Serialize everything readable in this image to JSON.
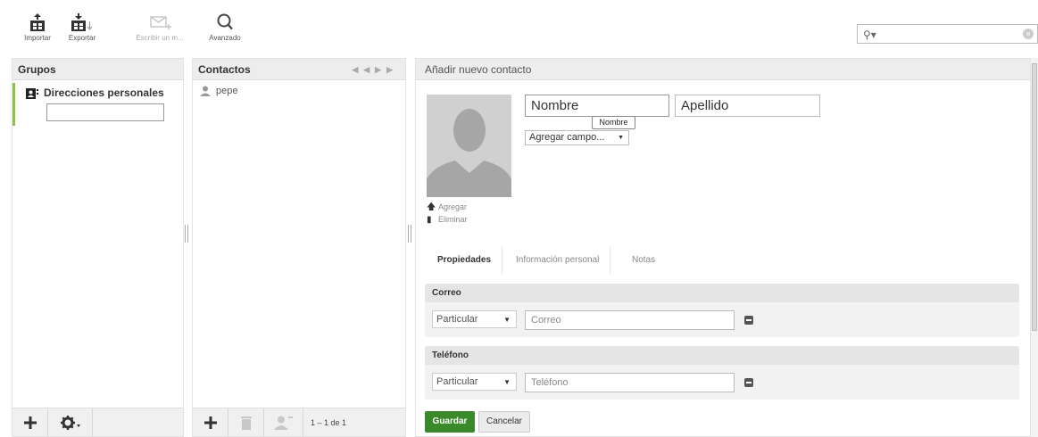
{
  "toolbar": {
    "importar": "Importar",
    "exportar": "Exportar",
    "escribir": "Escribir un m...",
    "avanzado": "Avanzado"
  },
  "search": {
    "value": ""
  },
  "groups": {
    "title": "Grupos",
    "items": [
      {
        "label": "Direcciones personales"
      }
    ],
    "new_group_value": ""
  },
  "contacts": {
    "title": "Contactos",
    "items": [
      {
        "name": "pepe"
      }
    ],
    "page_count": "1 – 1 de 1"
  },
  "editor": {
    "title": "Añadir nuevo contacto",
    "first_name_placeholder": "Nombre",
    "last_name_placeholder": "Apellido",
    "tooltip": "Nombre",
    "add_field": "Agregar campo...",
    "photo_add": "Agregar",
    "photo_delete": "Eliminar",
    "tabs": [
      {
        "label": "Propiedades"
      },
      {
        "label": "Información personal"
      },
      {
        "label": "Notas"
      }
    ],
    "sections": {
      "correo": {
        "title": "Correo",
        "type": "Particular",
        "placeholder": "Correo"
      },
      "telefono": {
        "title": "Teléfono",
        "type": "Particular",
        "placeholder": "Teléfono"
      }
    },
    "save_label": "Guardar",
    "cancel_label": "Cancelar"
  },
  "colors": {
    "accent_green": "#8bc34a",
    "save_button": "#3a8a2a"
  }
}
